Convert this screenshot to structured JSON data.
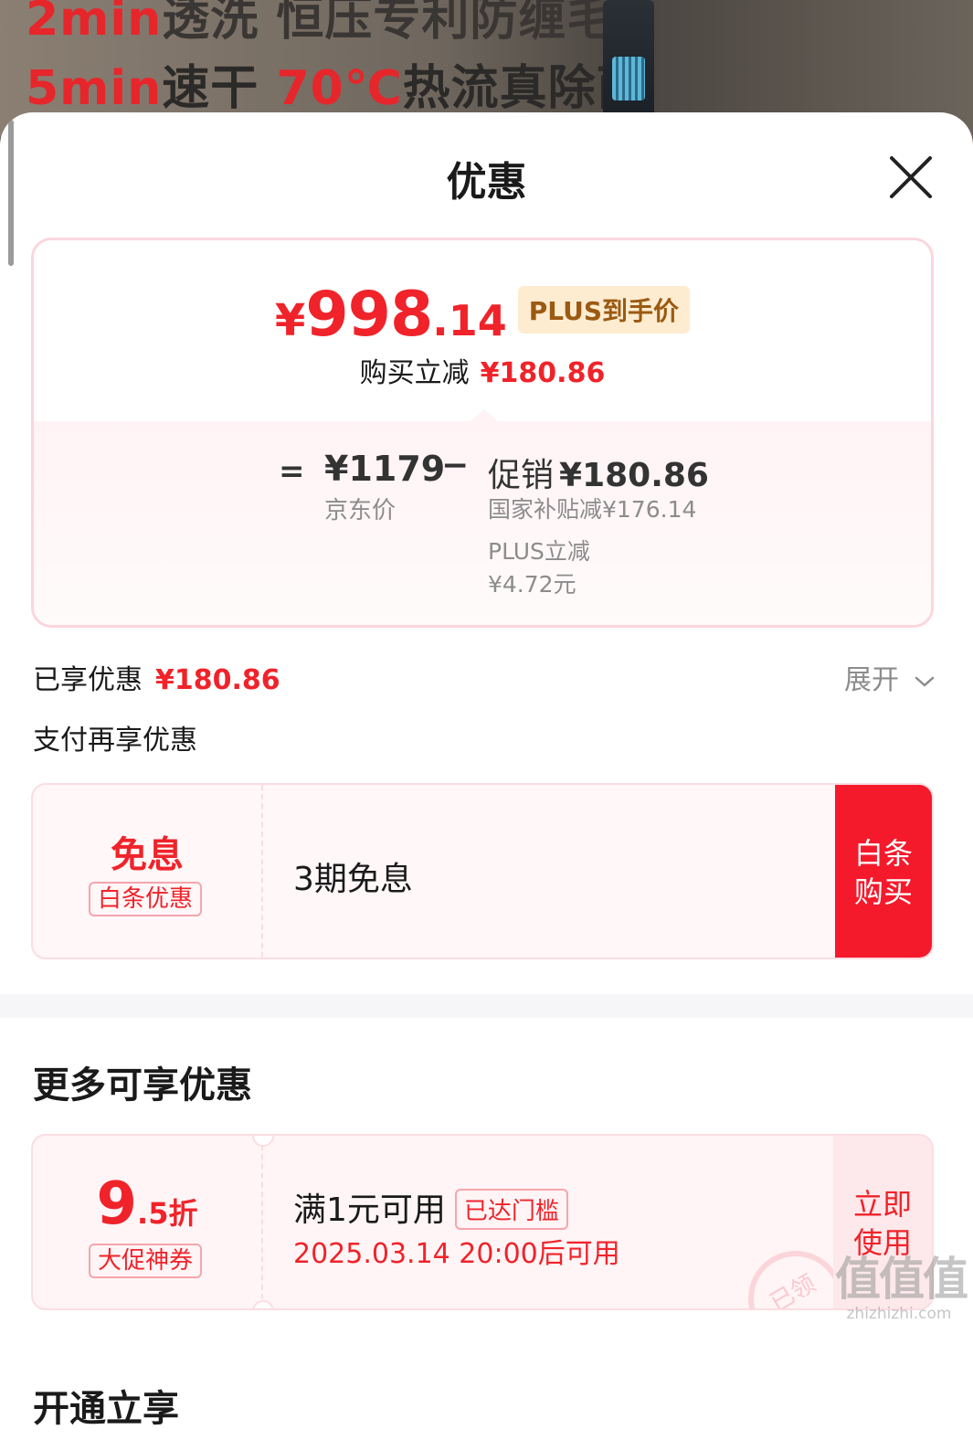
{
  "banner": {
    "line1_a": "2min",
    "line1_b": "透洗 恒压专利防缠毛",
    "line2_a": "5min",
    "line2_b": "速干 ",
    "line2_c": "70℃",
    "line2_d": "热流真除菌"
  },
  "sheet": {
    "title": "优惠"
  },
  "price": {
    "yen": "¥",
    "integer": "998",
    "decimal": ".14",
    "tag": "PLUS到手价",
    "save_label": "购买立减",
    "save_amount": "¥180.86",
    "equals": "=",
    "jd_price": "¥1179",
    "jd_label": "京东价",
    "minus": "−",
    "promo_label": "促销",
    "promo_amount": "¥180.86",
    "subsidy": "国家补贴减¥176.14",
    "plus_label": "PLUS立减",
    "plus_amount": "¥4.72元"
  },
  "enjoyed": {
    "label": "已享优惠",
    "amount": "¥180.86",
    "expand": "展开"
  },
  "pay_more": {
    "title": "支付再享优惠",
    "card": {
      "big": "免息",
      "tag": "白条优惠",
      "text": "3期免息",
      "button": "白条购买"
    }
  },
  "more": {
    "title": "更多可享优惠",
    "coupon": {
      "discount_big": "9",
      "discount_small": ".5折",
      "tag": "大促神券",
      "condition": "满1元可用",
      "badge": "已达门槛",
      "time": "2025.03.14 20:00后可用",
      "stamp": "已领",
      "button": "立即使用"
    }
  },
  "open": {
    "title": "开通立享"
  },
  "watermark": {
    "big": "值值值",
    "small": "zhizhizhi.com"
  },
  "colors": {
    "accent_red": "#f0232a",
    "button_red": "#f41a2c",
    "plus_tag_bg": "#fdecd0",
    "plus_tag_text": "#9b5a12"
  }
}
